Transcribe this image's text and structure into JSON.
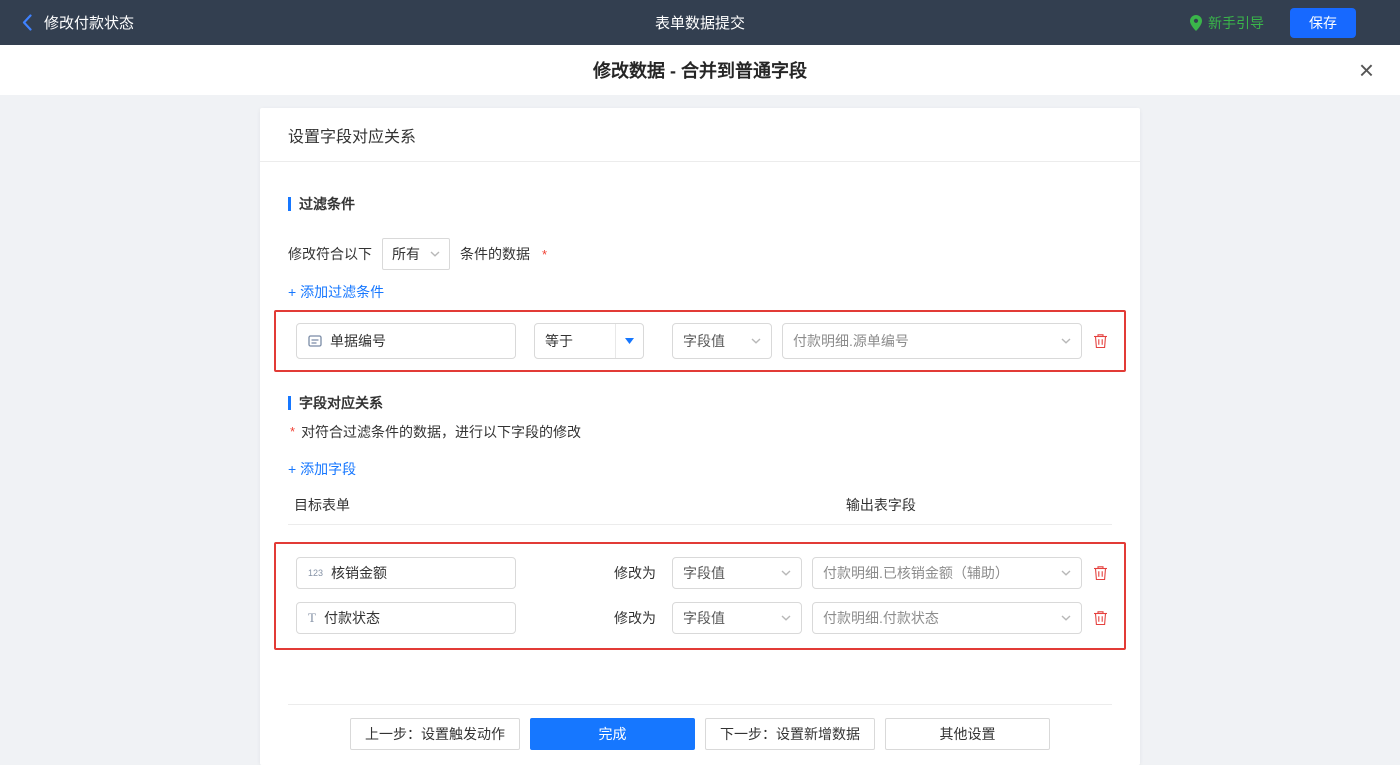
{
  "topbar": {
    "back_label": "修改付款状态",
    "title": "表单数据提交",
    "guide_label": "新手引导",
    "save_label": "保存"
  },
  "dialog": {
    "title": "修改数据 - 合并到普通字段",
    "close_glyph": "×"
  },
  "panel": {
    "header": "设置字段对应关系",
    "filter": {
      "section_title": "过滤条件",
      "prefix_label": "修改符合以下",
      "match_value": "所有",
      "suffix_label": "条件的数据",
      "required_mark": "*",
      "add_link": "+ 添加过滤条件",
      "rows": [
        {
          "field": "单据编号",
          "operator": "等于",
          "value_type": "字段值",
          "value": "付款明细.源单编号"
        }
      ]
    },
    "mapping": {
      "section_title": "字段对应关系",
      "required_mark": "*",
      "description": "对符合过滤条件的数据，进行以下字段的修改",
      "add_link": "+ 添加字段",
      "col_target": "目标表单",
      "col_output": "输出表字段",
      "rows": [
        {
          "type_icon": "123",
          "field": "核销金额",
          "modify_label": "修改为",
          "value_type": "字段值",
          "value": "付款明细.已核销金额（辅助）"
        },
        {
          "type_icon": "T",
          "field": "付款状态",
          "modify_label": "修改为",
          "value_type": "字段值",
          "value": "付款明细.付款状态"
        }
      ]
    },
    "footer": {
      "prev_label": "上一步：设置触发动作",
      "done_label": "完成",
      "next_label": "下一步：设置新增数据",
      "other_label": "其他设置"
    }
  },
  "colors": {
    "accent_blue": "#1677ff",
    "danger_red": "#e23b36",
    "guide_green": "#3ab54a",
    "topbar_bg": "#333f50"
  }
}
